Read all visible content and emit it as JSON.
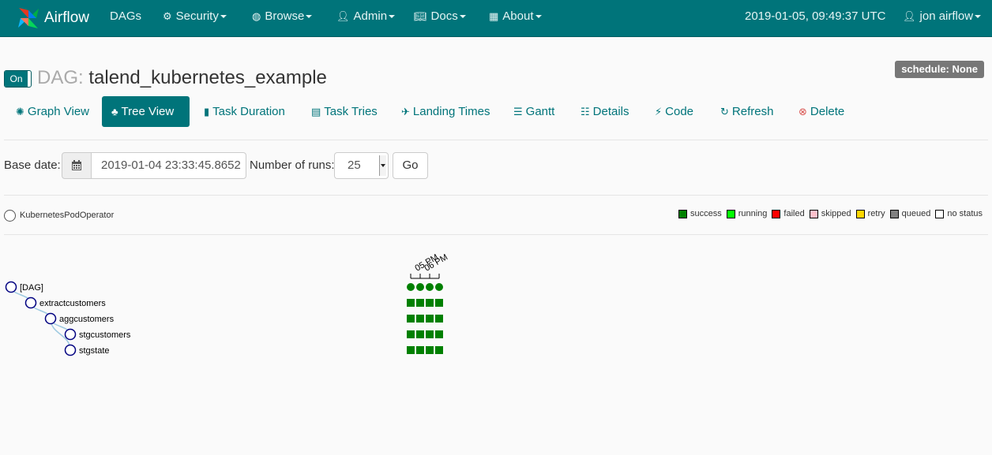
{
  "navbar": {
    "brand": "Airflow",
    "items": [
      {
        "label": "DAGs",
        "icon": "none",
        "dropdown": false
      },
      {
        "label": "Security",
        "icon": "cogs-icon",
        "dropdown": true
      },
      {
        "label": "Browse",
        "icon": "globe-icon",
        "dropdown": true
      },
      {
        "label": "Admin",
        "icon": "user-icon",
        "dropdown": true
      },
      {
        "label": "Docs",
        "icon": "book-icon",
        "dropdown": true
      },
      {
        "label": "About",
        "icon": "grid-icon",
        "dropdown": true
      }
    ],
    "datetime": "2019-01-05, 09:49:37 UTC",
    "user": "jon airflow"
  },
  "dag": {
    "toggle_label": "On",
    "prefix": "DAG:",
    "name": "talend_kubernetes_example",
    "schedule": "schedule: None"
  },
  "tabs": [
    {
      "label": "Graph View",
      "icon": "asterisk-icon",
      "active": false
    },
    {
      "label": "Tree View",
      "icon": "tree-icon",
      "active": true
    },
    {
      "label": "Task Duration",
      "icon": "bar-chart-icon",
      "active": false
    },
    {
      "label": "Task Tries",
      "icon": "file-icon",
      "active": false
    },
    {
      "label": "Landing Times",
      "icon": "plane-icon",
      "active": false
    },
    {
      "label": "Gantt",
      "icon": "align-left-icon",
      "active": false
    },
    {
      "label": "Details",
      "icon": "list-icon",
      "active": false
    },
    {
      "label": "Code",
      "icon": "flash-icon",
      "active": false
    },
    {
      "label": "Refresh",
      "icon": "refresh-icon",
      "active": false
    },
    {
      "label": "Delete",
      "icon": "remove-icon",
      "active": false
    }
  ],
  "form": {
    "base_date_label": "Base date:",
    "base_date_value": "2019-01-04 23:33:45.8652",
    "runs_label": "Number of runs:",
    "runs_value": "25",
    "go_label": "Go"
  },
  "operator_legend": {
    "label": "KubernetesPodOperator"
  },
  "state_legend": [
    {
      "label": "success",
      "color": "#008000"
    },
    {
      "label": "running",
      "color": "#00ff00"
    },
    {
      "label": "failed",
      "color": "#ff0000"
    },
    {
      "label": "skipped",
      "color": "#ffc0cb"
    },
    {
      "label": "retry",
      "color": "#ffd700"
    },
    {
      "label": "queued",
      "color": "#808080"
    },
    {
      "label": "no status",
      "color": "#ffffff"
    }
  ],
  "tree": {
    "time_labels": [
      "05 PM",
      "06 PM"
    ],
    "nodes": [
      {
        "label": "[DAG]",
        "depth": 0
      },
      {
        "label": "extractcustomers",
        "depth": 1
      },
      {
        "label": "aggcustomers",
        "depth": 2
      },
      {
        "label": "stgcustomers",
        "depth": 3
      },
      {
        "label": "stgstate",
        "depth": 3
      }
    ],
    "runs": 4,
    "run_state": "success"
  },
  "colors": {
    "navbar": "#00747a",
    "accent": "#00747a",
    "success": "#008000"
  }
}
